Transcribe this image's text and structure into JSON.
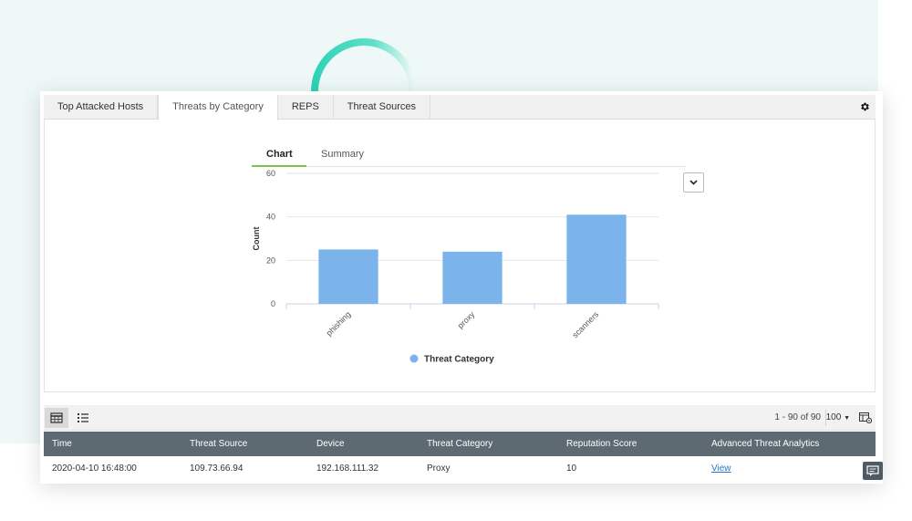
{
  "tabs": [
    {
      "label": "Top Attacked Hosts"
    },
    {
      "label": "Threats by Category"
    },
    {
      "label": "REPS"
    },
    {
      "label": "Threat Sources"
    }
  ],
  "active_tab": "Threats by Category",
  "subtabs": {
    "chart": "Chart",
    "summary": "Summary"
  },
  "chart_data": {
    "type": "bar",
    "categories": [
      "phishing",
      "proxy",
      "scanners"
    ],
    "values": [
      25,
      24,
      41
    ],
    "title": "",
    "xlabel": "",
    "ylabel": "Count",
    "ylim": [
      0,
      60
    ],
    "yticks": [
      0,
      20,
      40,
      60
    ],
    "series": [
      {
        "name": "Threat Category",
        "values": [
          25,
          24,
          41
        ]
      }
    ],
    "legend": "bottom-center",
    "grid": true,
    "bar_color": "#7ab4ea"
  },
  "toolbar": {
    "pager_text": "1 - 90 of 90",
    "per_page": "100"
  },
  "table": {
    "columns": [
      "Time",
      "Threat Source",
      "Device",
      "Threat Category",
      "Reputation Score",
      "Advanced Threat Analytics"
    ],
    "rows": [
      [
        "2020-04-10 16:48:00",
        "109.73.66.94",
        "192.168.111.32",
        "Proxy",
        "10",
        "View"
      ]
    ]
  },
  "colors": {
    "accent_green": "#7cc24e",
    "header_bg": "#5e6a72",
    "link": "#2b76c8",
    "arc": "#2ed3b7"
  }
}
